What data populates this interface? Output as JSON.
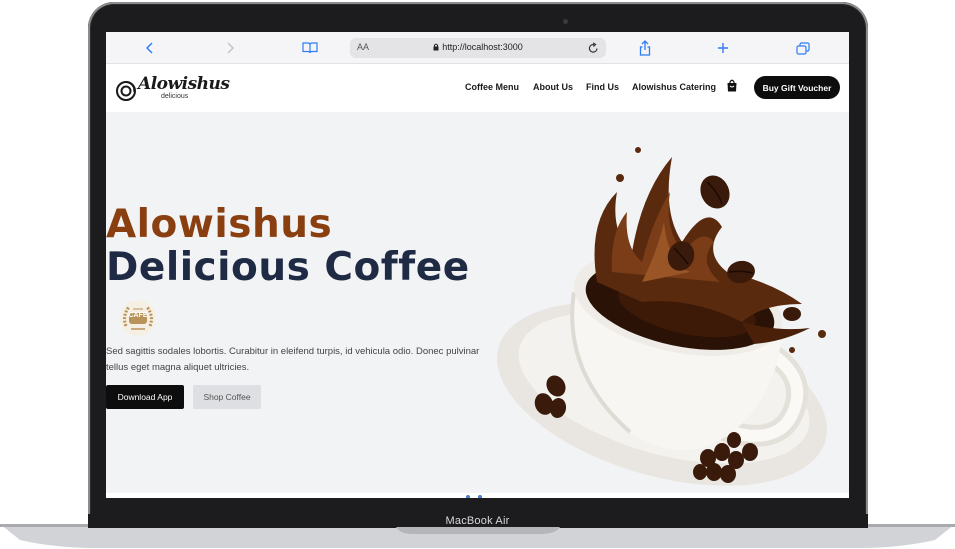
{
  "device": {
    "label": "MacBook Air"
  },
  "browser": {
    "text_size_label": "AA",
    "url": "http://localhost:3000",
    "icons": [
      "chevron-left-icon",
      "chevron-right-icon",
      "book-icon",
      "lock-icon",
      "reload-icon",
      "share-icon",
      "plus-icon",
      "tabs-icon"
    ]
  },
  "site": {
    "logo": {
      "word": "Alowishus",
      "sub": "delicious"
    },
    "nav": [
      {
        "label": "Coffee Menu"
      },
      {
        "label": "About Us"
      },
      {
        "label": "Find Us"
      },
      {
        "label": "Alowishus Catering"
      }
    ],
    "cart_icon": "shopping-bag-icon",
    "voucher_label": "Buy Gift Voucher"
  },
  "hero": {
    "title_line1": "Alowishus",
    "title_line2": "Delicious Coffee",
    "badge_text": "CAFE",
    "description": "Sed sagittis sodales lobortis. Curabitur in eleifend turpis, id vehicula odio. Donec pulvinar tellus eget magna aliquet ultricies.",
    "primary_button": "Download App",
    "secondary_button": "Shop Coffee"
  },
  "colors": {
    "accent_brown": "#8a3f10",
    "navy": "#1f2a44",
    "button_dark": "#0d0d0d",
    "link_blue": "#2f7cf6"
  }
}
